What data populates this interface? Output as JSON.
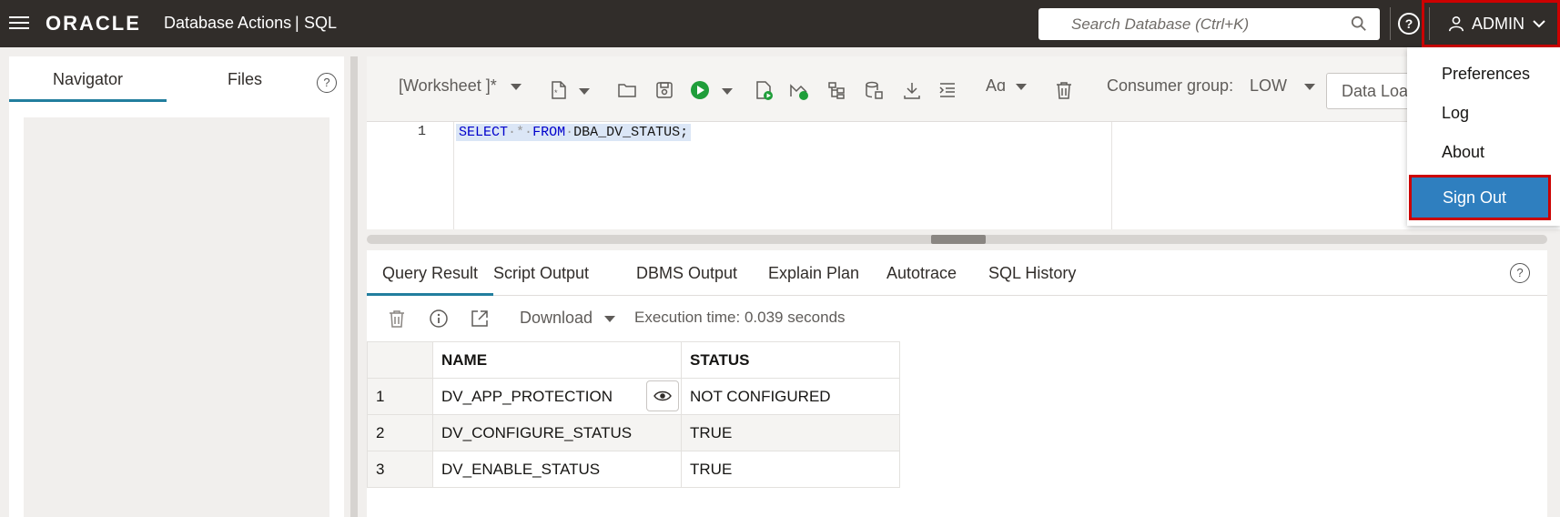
{
  "header": {
    "logo": "ORACLE",
    "app_title": "Database Actions",
    "separator": "|",
    "section": "SQL",
    "search_placeholder": "Search Database (Ctrl+K)",
    "help": "?",
    "user": "ADMIN"
  },
  "left_panel": {
    "tabs": [
      "Navigator",
      "Files"
    ],
    "help": "?"
  },
  "toolbar": {
    "worksheet": "[Worksheet ]*",
    "consumer_group_label": "Consumer group:",
    "consumer_group_value": "LOW",
    "data_load": "Data Load"
  },
  "editor": {
    "line_number": "1",
    "code": {
      "kw1": "SELECT",
      "star": "*",
      "kw2": "FROM",
      "rest": "DBA_DV_STATUS;"
    }
  },
  "result": {
    "tabs": [
      "Query Result",
      "Script Output",
      "DBMS Output",
      "Explain Plan",
      "Autotrace",
      "SQL History"
    ],
    "help": "?",
    "download": "Download",
    "exec_time": "Execution time: 0.039 seconds",
    "columns": [
      "NAME",
      "STATUS"
    ],
    "rows": [
      {
        "n": "1",
        "name": "DV_APP_PROTECTION",
        "status": "NOT CONFIGURED"
      },
      {
        "n": "2",
        "name": "DV_CONFIGURE_STATUS",
        "status": "TRUE"
      },
      {
        "n": "3",
        "name": "DV_ENABLE_STATUS",
        "status": "TRUE"
      }
    ]
  },
  "user_menu": {
    "items": [
      "Preferences",
      "Log",
      "About",
      "Sign Out"
    ]
  },
  "colors": {
    "header_bg": "#312d2a",
    "accent": "#227e9e",
    "sign_out_bg": "#2f7fbf",
    "highlight_border": "#cc0000"
  }
}
